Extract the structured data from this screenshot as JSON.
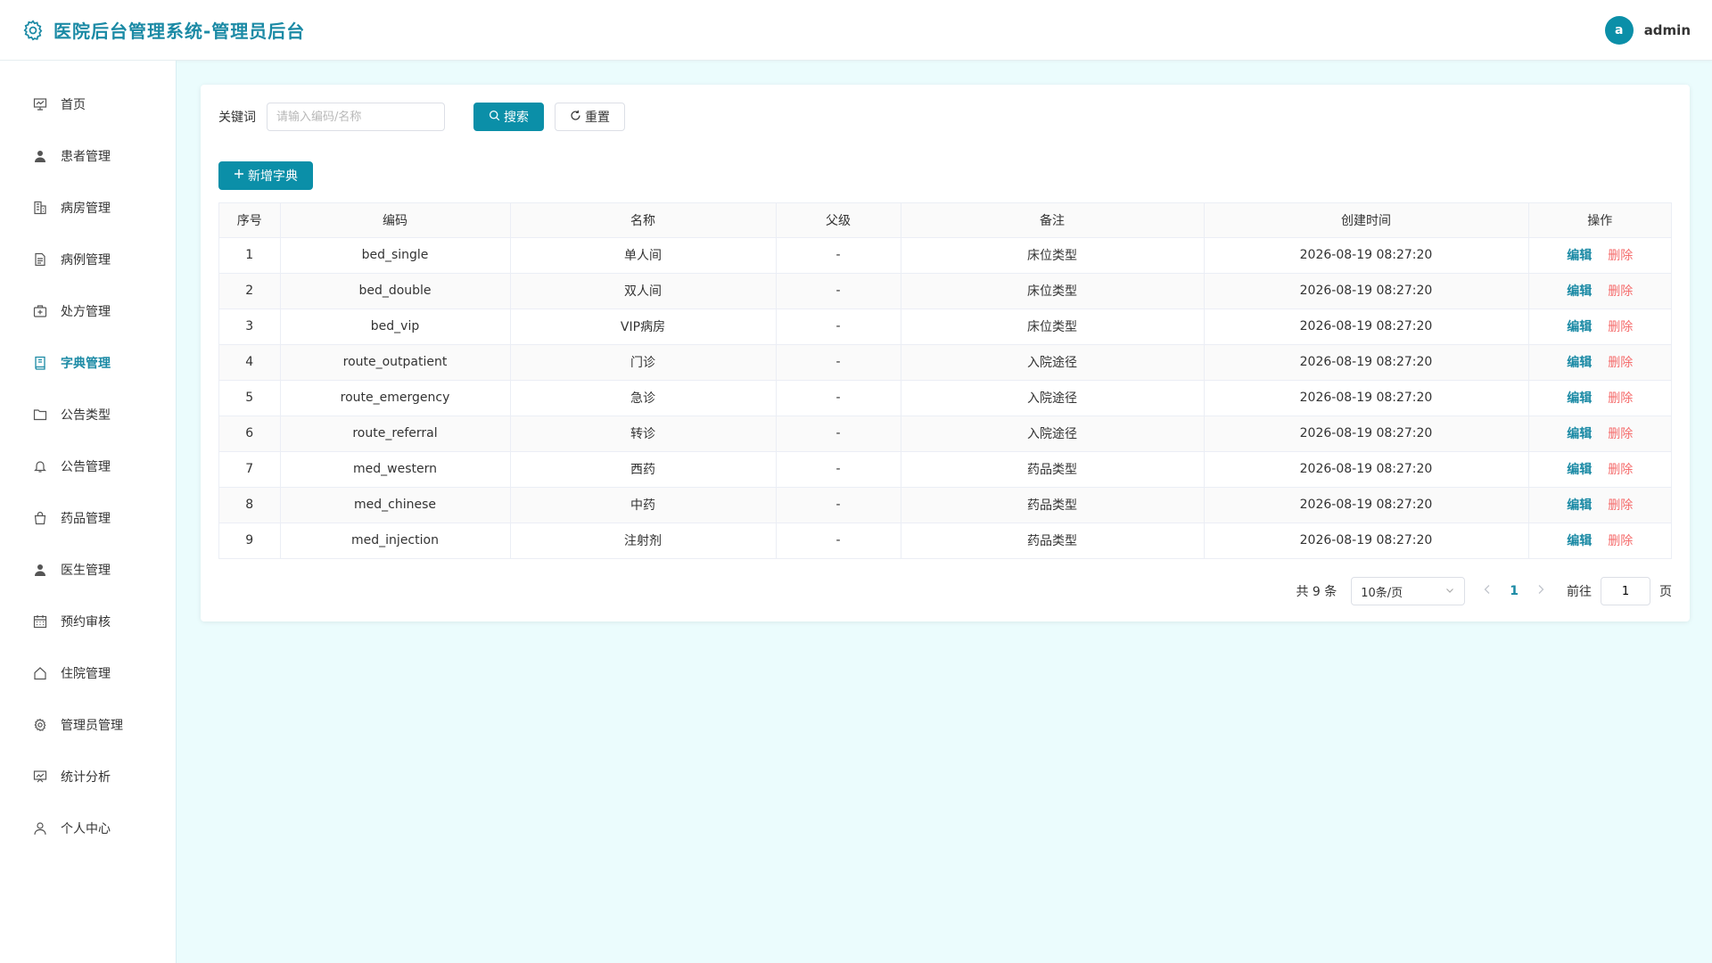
{
  "header": {
    "title": "医院后台管理系统-管理员后台",
    "user": {
      "avatar_letter": "a",
      "name": "admin"
    }
  },
  "sidebar": {
    "items": [
      {
        "label": "首页",
        "icon": "dashboard-icon"
      },
      {
        "label": "患者管理",
        "icon": "user-icon"
      },
      {
        "label": "病房管理",
        "icon": "building-icon"
      },
      {
        "label": "病例管理",
        "icon": "document-icon"
      },
      {
        "label": "处方管理",
        "icon": "medical-kit-icon"
      },
      {
        "label": "字典管理",
        "icon": "book-icon",
        "active": true
      },
      {
        "label": "公告类型",
        "icon": "folder-icon"
      },
      {
        "label": "公告管理",
        "icon": "bell-icon"
      },
      {
        "label": "药品管理",
        "icon": "bag-icon"
      },
      {
        "label": "医生管理",
        "icon": "doctor-icon"
      },
      {
        "label": "预约审核",
        "icon": "calendar-icon"
      },
      {
        "label": "住院管理",
        "icon": "house-icon"
      },
      {
        "label": "管理员管理",
        "icon": "gear-icon"
      },
      {
        "label": "统计分析",
        "icon": "chart-board-icon"
      },
      {
        "label": "个人中心",
        "icon": "person-outline-icon"
      }
    ]
  },
  "search": {
    "label": "关键词",
    "placeholder": "请输入编码/名称",
    "value": "",
    "search_label": "搜索",
    "reset_label": "重置"
  },
  "toolbar": {
    "add_label": "新增字典"
  },
  "table": {
    "headers": [
      "序号",
      "编码",
      "名称",
      "父级",
      "备注",
      "创建时间",
      "操作"
    ],
    "rows": [
      {
        "idx": "1",
        "code": "bed_single",
        "name": "单人间",
        "parent": "-",
        "remark": "床位类型",
        "created": "2026-08-19 08:27:20"
      },
      {
        "idx": "2",
        "code": "bed_double",
        "name": "双人间",
        "parent": "-",
        "remark": "床位类型",
        "created": "2026-08-19 08:27:20"
      },
      {
        "idx": "3",
        "code": "bed_vip",
        "name": "VIP病房",
        "parent": "-",
        "remark": "床位类型",
        "created": "2026-08-19 08:27:20"
      },
      {
        "idx": "4",
        "code": "route_outpatient",
        "name": "门诊",
        "parent": "-",
        "remark": "入院途径",
        "created": "2026-08-19 08:27:20"
      },
      {
        "idx": "5",
        "code": "route_emergency",
        "name": "急诊",
        "parent": "-",
        "remark": "入院途径",
        "created": "2026-08-19 08:27:20"
      },
      {
        "idx": "6",
        "code": "route_referral",
        "name": "转诊",
        "parent": "-",
        "remark": "入院途径",
        "created": "2026-08-19 08:27:20"
      },
      {
        "idx": "7",
        "code": "med_western",
        "name": "西药",
        "parent": "-",
        "remark": "药品类型",
        "created": "2026-08-19 08:27:20"
      },
      {
        "idx": "8",
        "code": "med_chinese",
        "name": "中药",
        "parent": "-",
        "remark": "药品类型",
        "created": "2026-08-19 08:27:20"
      },
      {
        "idx": "9",
        "code": "med_injection",
        "name": "注射剂",
        "parent": "-",
        "remark": "药品类型",
        "created": "2026-08-19 08:27:20"
      }
    ],
    "edit_label": "编辑",
    "delete_label": "删除"
  },
  "pagination": {
    "total_text": "共 9 条",
    "page_size": "10条/页",
    "current_page": "1",
    "goto_prefix": "前往",
    "goto_value": "1",
    "goto_suffix": "页"
  },
  "colors": {
    "accent": "#1b8aa5",
    "primary_button": "#0b8fa8",
    "danger": "#f56c6c",
    "background": "#ebfcfd"
  }
}
